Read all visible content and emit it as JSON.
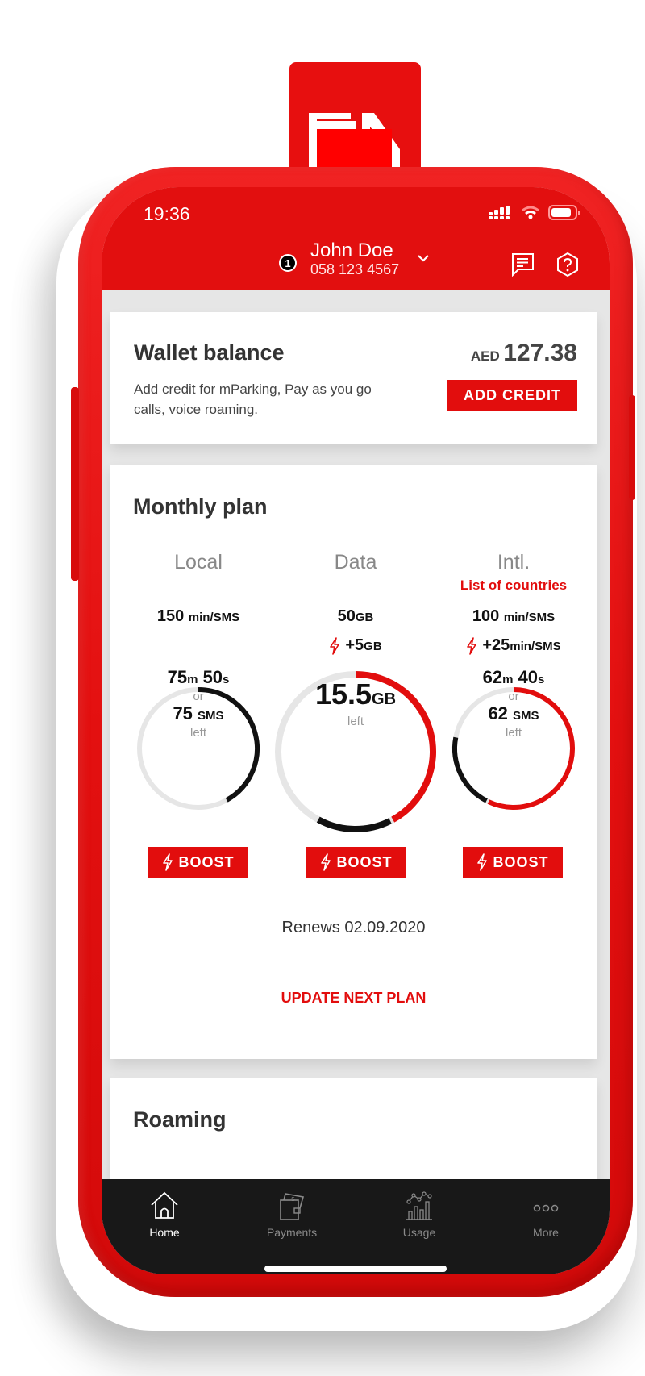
{
  "status_bar": {
    "time": "19:36"
  },
  "header": {
    "account_badge": "1",
    "user_name": "John Doe",
    "phone_number": "058 123 4567",
    "icons": [
      "chevron-down-icon",
      "chat-icon",
      "help-icon"
    ]
  },
  "wallet": {
    "title": "Wallet balance",
    "description": "Add credit for mParking, Pay as you go calls, voice roaming.",
    "currency": "AED",
    "amount": "127.38",
    "button_label": "ADD CREDIT"
  },
  "monthly_plan": {
    "title": "Monthly plan",
    "columns": [
      {
        "label": "Local",
        "link": "",
        "allowance_value": "150",
        "allowance_unit": "min/SMS",
        "boost_value": "",
        "boost_unit": "",
        "remaining_main_value": "75",
        "remaining_main_unit": "m",
        "remaining_secondary_value": "50",
        "remaining_secondary_unit": "s",
        "or_label": "or",
        "alt_value": "75",
        "alt_unit": "SMS",
        "left_label": "left",
        "ring_segments": [
          {
            "color": "#111111",
            "fraction": 0.42
          }
        ],
        "boost_button": "BOOST"
      },
      {
        "label": "Data",
        "link": "",
        "allowance_value": "50",
        "allowance_unit": "GB",
        "boost_value": "+5",
        "boost_unit": "GB",
        "remaining_main_value": "15.5",
        "remaining_main_unit": "GB",
        "left_label": "left",
        "ring_segments": [
          {
            "color": "#e20d0d",
            "fraction": 0.42
          },
          {
            "color": "#111111",
            "fraction": 0.16
          }
        ],
        "boost_button": "BOOST"
      },
      {
        "label": "Intl.",
        "link": "List of countries",
        "allowance_value": "100",
        "allowance_unit": "min/SMS",
        "boost_value": "+25",
        "boost_unit": "min/SMS",
        "remaining_main_value": "62",
        "remaining_main_unit": "m",
        "remaining_secondary_value": "40",
        "remaining_secondary_unit": "s",
        "or_label": "or",
        "alt_value": "62",
        "alt_unit": "SMS",
        "left_label": "left",
        "ring_segments": [
          {
            "color": "#e20d0d",
            "fraction": 0.57
          },
          {
            "color": "#111111",
            "fraction": 0.21
          }
        ],
        "boost_button": "BOOST"
      }
    ],
    "renews_text": "Renews 02.09.2020",
    "update_link": "UPDATE NEXT PLAN"
  },
  "roaming": {
    "title": "Roaming"
  },
  "tab_bar": {
    "tabs": [
      {
        "label": "Home",
        "icon": "home-icon",
        "active": true
      },
      {
        "label": "Payments",
        "icon": "wallet-icon",
        "active": false
      },
      {
        "label": "Usage",
        "icon": "chart-icon",
        "active": false
      },
      {
        "label": "More",
        "icon": "more-icon",
        "active": false
      }
    ]
  },
  "colors": {
    "brand_red": "#e20d0d",
    "tabbar_bg": "#181818",
    "ring_track": "#e6e6e6"
  }
}
